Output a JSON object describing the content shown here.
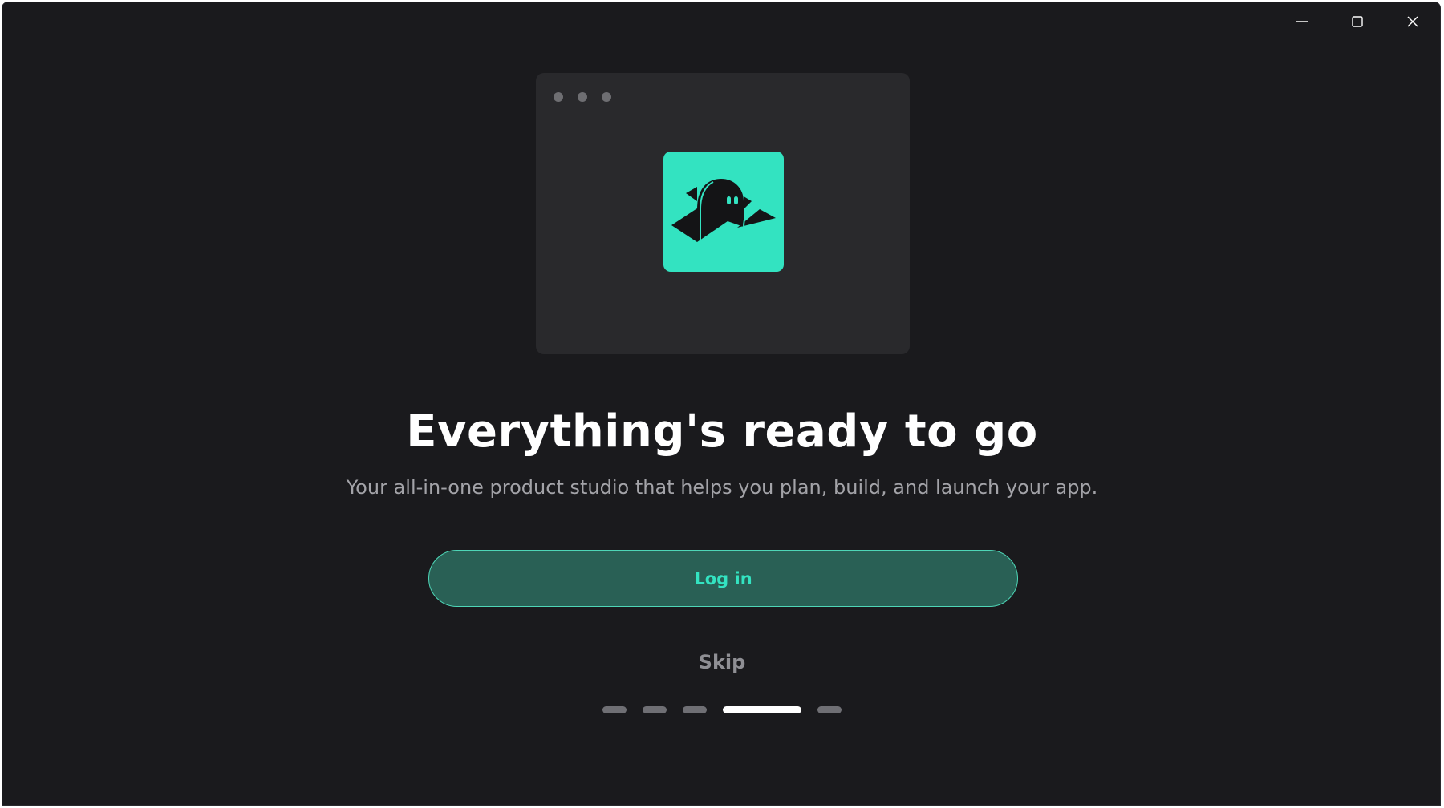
{
  "window": {
    "controls": {
      "minimize_icon": "minimize-icon",
      "maximize_icon": "maximize-icon",
      "close_icon": "close-icon"
    }
  },
  "hero": {
    "logo_icon": "ghost-logo-icon",
    "logo_color": "#33e3c1",
    "card_dots": 3
  },
  "content": {
    "title": "Everything's ready to go",
    "subtitle": "Your all-in-one product studio that helps you plan, build, and launch your app."
  },
  "actions": {
    "login_label": "Log in",
    "skip_label": "Skip"
  },
  "pager": {
    "total": 5,
    "active_index": 3
  },
  "colors": {
    "background": "#1a1a1d",
    "accent": "#33e3c1",
    "button_fill": "#296055"
  }
}
